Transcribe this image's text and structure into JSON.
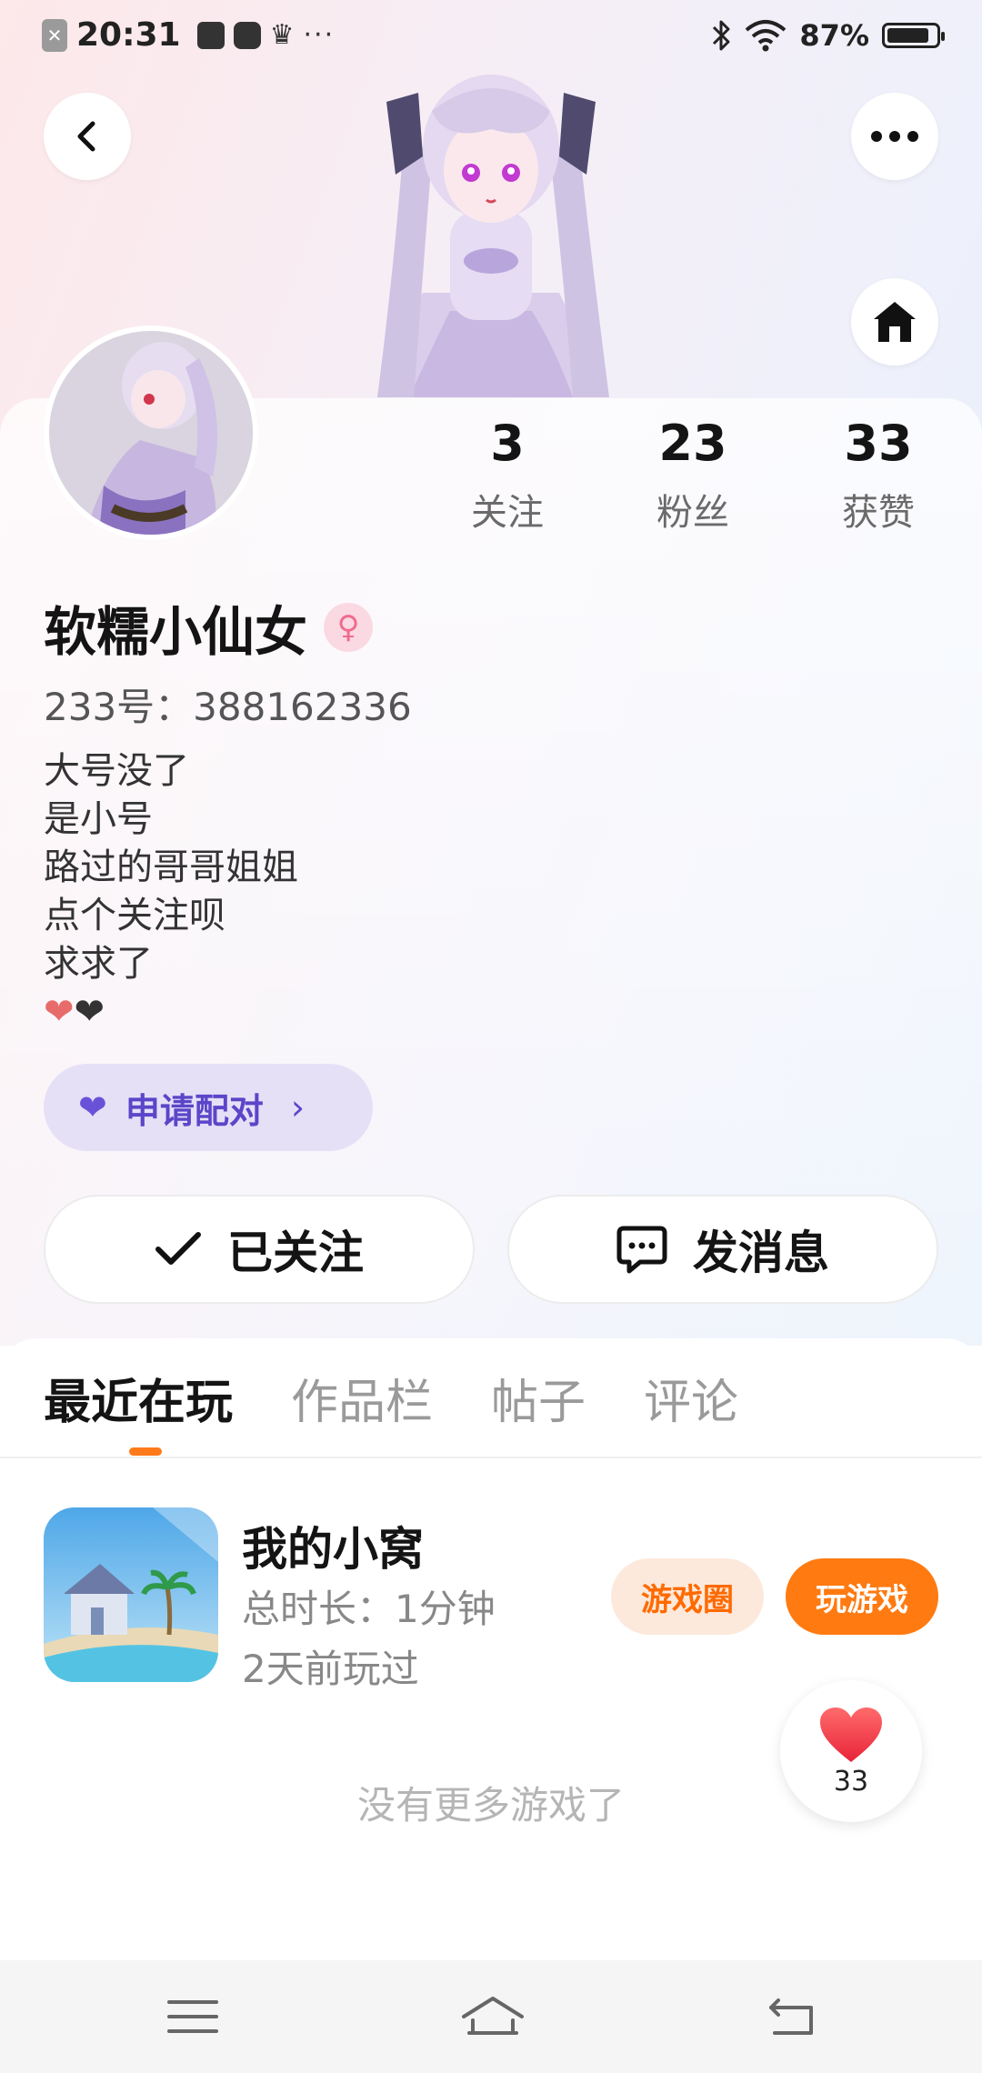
{
  "status_bar": {
    "time": "20:31",
    "battery": "87%",
    "battery_level": 0.87,
    "more_indicator": "···",
    "icons": [
      "close-notification-icon",
      "app-icon",
      "message-icon",
      "crown-icon",
      "bluetooth-icon",
      "wifi-icon",
      "battery-icon"
    ]
  },
  "header": {
    "back_icon": "chevron-left-icon",
    "more_icon": "more-dots-icon",
    "home_icon": "home-icon"
  },
  "profile": {
    "stats": [
      {
        "value": "3",
        "label": "关注"
      },
      {
        "value": "23",
        "label": "粉丝"
      },
      {
        "value": "33",
        "label": "获赞"
      }
    ],
    "name": "软糯小仙女",
    "gender_icon": "female-icon",
    "uid": "233号：388162336",
    "bio": [
      "大号没了",
      "是小号",
      "路过的哥哥姐姐",
      "点个关注呗",
      "求求了"
    ],
    "bio_hearts": [
      "❤",
      "❤"
    ],
    "pair_button": {
      "label": "申请配对",
      "chevron": "›",
      "icon": "hearts-icon"
    },
    "follow_button": {
      "label": "已关注",
      "icon": "check-icon"
    },
    "message_button": {
      "label": "发消息",
      "icon": "chat-bubble-icon"
    }
  },
  "tabs": [
    {
      "label": "最近在玩",
      "active": true
    },
    {
      "label": "作品栏",
      "active": false
    },
    {
      "label": "帖子",
      "active": false
    },
    {
      "label": "评论",
      "active": false
    }
  ],
  "games": [
    {
      "name": "我的小窝",
      "duration": "总时长：1分钟",
      "last_played": "2天前玩过",
      "circle_label": "游戏圈",
      "play_label": "玩游戏"
    }
  ],
  "likes_float": {
    "count": "33",
    "icon": "heart-icon"
  },
  "empty_text": "没有更多游戏了",
  "nav_bar": {
    "icons": [
      "menu-icon",
      "home-outline-icon",
      "back-arrow-icon"
    ]
  },
  "colors": {
    "accent_orange": "#ff7a10",
    "pair_purple": "#5b46c9",
    "heart_red": "#f0444f"
  }
}
